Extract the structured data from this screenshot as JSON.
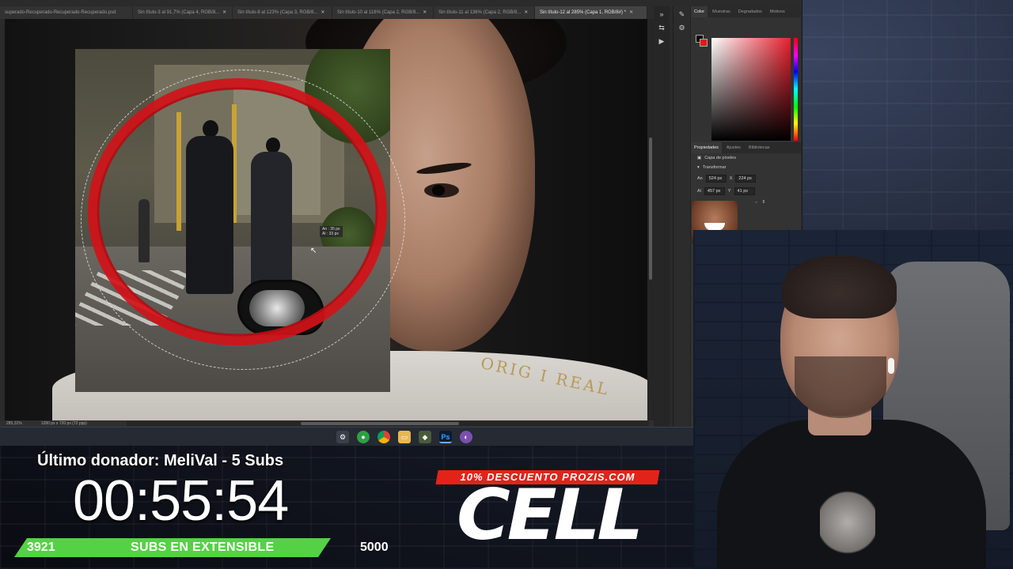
{
  "photoshop": {
    "tabs": [
      {
        "label": "superado-Recuperado-Recuperado-Recuperado.psd",
        "active": false
      },
      {
        "label": "Sin título-3 al 91,7% (Capa 4, RGB/8...",
        "active": false
      },
      {
        "label": "Sin título-8 al 123% (Capa 3, RGB/8...",
        "active": false
      },
      {
        "label": "Sin título-10 al 116% (Capa 2, RGB/8...",
        "active": false
      },
      {
        "label": "Sin título-11 al 136% (Capa 2, RGB/8...",
        "active": false
      },
      {
        "label": "Sin título-12 al 285% (Capa 1, RGB/8#) *",
        "active": true
      }
    ],
    "status": {
      "zoom": "285,31%",
      "doc_size": "1280 px x 720 px (72 ppp)"
    },
    "measure_tooltip": {
      "line1": "An : 35 px",
      "line2": "Al : 33 px"
    },
    "shirt_text": "ORIG    I REAL",
    "color_panel": {
      "tabs": [
        "Color",
        "Muestras",
        "Degradados",
        "Motivos"
      ],
      "active_tab": "Color",
      "foreground_color": "#000000",
      "background_color": "#e01a1a"
    },
    "properties_panel": {
      "tabs": [
        "Propiedades",
        "Ajustes",
        "Bibliotecas"
      ],
      "active_tab": "Propiedades",
      "layer_type": "Capa de píxeles",
      "section": "Transformar",
      "width": "524 px",
      "height": "457 px",
      "x": "224 px",
      "y": "41 px",
      "w_label": "An",
      "h_label": "Al",
      "x_label": "X",
      "y_label": "Y"
    },
    "meme_overlay": "x3"
  },
  "taskbar": {
    "icons": [
      "settings-icon",
      "messaging-icon",
      "chrome-icon",
      "folder-icon",
      "app-icon",
      "photoshop-icon",
      "paint-icon"
    ],
    "active": "photoshop-icon",
    "photoshop_label": "Ps"
  },
  "stream_overlay": {
    "donor": "Último donador: MeliVal - 5 Subs",
    "timer": "00:55:54",
    "subs_current": "3921",
    "subs_label": "SUBS EN EXTENSIBLE",
    "subs_goal": "5000",
    "subs_progress_fraction": 0.784,
    "promo_text": "10% DESCUENTO PROZIS.COM",
    "brand": "CELL",
    "accent_green": "#55d146",
    "accent_red": "#e2231a"
  }
}
